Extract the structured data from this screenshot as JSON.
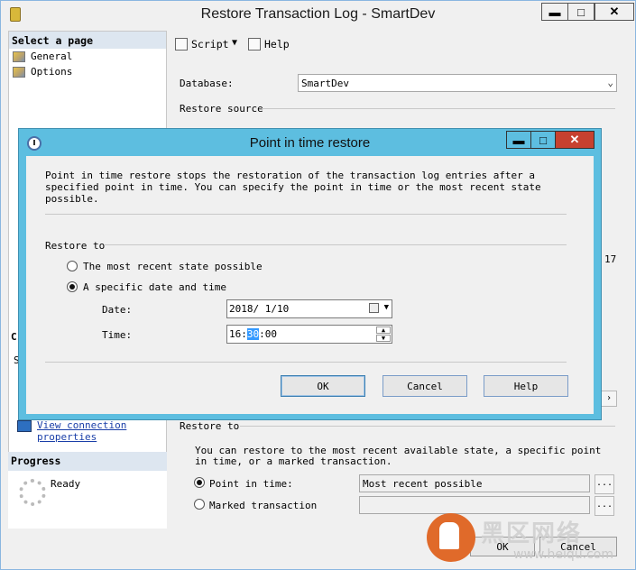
{
  "window": {
    "title": "Restore Transaction Log  -  SmartDev",
    "min": "▬",
    "max": "□",
    "close": "✕"
  },
  "left": {
    "header": "Select a page",
    "pages": [
      {
        "label": "General"
      },
      {
        "label": "Options"
      }
    ],
    "connection_link_line1": "View connection",
    "connection_link_line2": "properties",
    "progress_header": "Progress",
    "progress_status": "Ready",
    "fragment_c": "C",
    "fragment_s": "S"
  },
  "toolbar": {
    "script": "Script",
    "dropdown": "▼",
    "help": "Help"
  },
  "main": {
    "database_label": "Database:",
    "database_value": "SmartDev",
    "restore_source": "Restore source",
    "partial_17": "17",
    "restore_to": "Restore to",
    "restore_to_desc": "You can restore to the most recent available state, a specific point in time, or a marked transaction.",
    "point_in_time_label": "Point in time:",
    "point_in_time_value": "Most recent possible",
    "marked_transaction_label": "Marked transaction",
    "ellipsis": "...",
    "ok": "OK",
    "cancel": "Cancel"
  },
  "dialog": {
    "title": "Point in time restore",
    "min": "▬",
    "max": "□",
    "close": "✕",
    "description": "Point in time restore stops the restoration of the transaction log entries after a specified point in time. You can specify the point in time or the most recent state possible.",
    "restore_to": "Restore to",
    "opt_recent": "The most recent state possible",
    "opt_specific": "A specific date and time",
    "date_label": "Date:",
    "date_value": "2018/ 1/10",
    "time_label": "Time:",
    "time_h": "16",
    "time_sep1": ":",
    "time_m": "30",
    "time_sep2": ":00",
    "ok": "OK",
    "cancel": "Cancel",
    "help": "Help"
  },
  "watermark": {
    "brand": "黑区网络",
    "url": "www.heiqu.com"
  }
}
